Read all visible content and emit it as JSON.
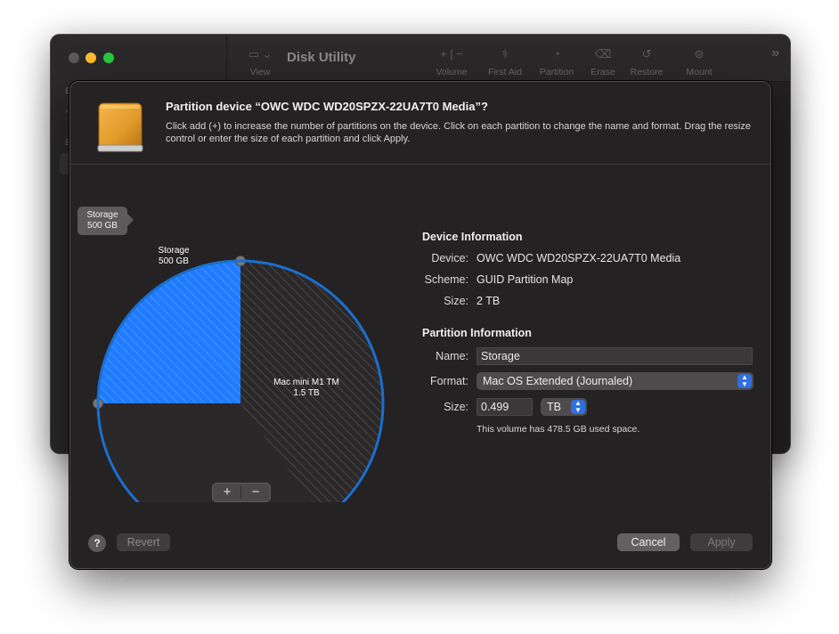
{
  "background_window": {
    "title": "Disk Utility",
    "toolbar": {
      "view_label": "View",
      "volume_label": "Volume",
      "first_aid_label": "First Aid",
      "partition_label": "Partition",
      "erase_label": "Erase",
      "restore_label": "Restore",
      "mount_label": "Mount"
    }
  },
  "sheet": {
    "title": "Partition device “OWC WDC WD20SPZX-22UA7T0 Media”?",
    "description": "Click add (+) to increase the number of partitions on the device. Click on each partition to change the name and format. Drag the resize control or enter the size of each partition and click Apply."
  },
  "chart_data": {
    "type": "pie",
    "slices": [
      {
        "name": "Storage",
        "size_label": "500 GB",
        "value": 500,
        "selected": true,
        "color": "#1f7bff"
      },
      {
        "name": "Mac mini M1 TM",
        "size_label": "1.5 TB",
        "value": 1500,
        "selected": false,
        "color": "#2a2828"
      }
    ],
    "tooltip": {
      "name": "Storage",
      "size": "500 GB"
    }
  },
  "partition_controls": {
    "add_symbol": "+",
    "remove_symbol": "−"
  },
  "device_information": {
    "heading": "Device Information",
    "device_label": "Device:",
    "device_value": "OWC WDC WD20SPZX-22UA7T0 Media",
    "scheme_label": "Scheme:",
    "scheme_value": "GUID Partition Map",
    "size_label": "Size:",
    "size_value": "2 TB"
  },
  "partition_information": {
    "heading": "Partition Information",
    "name_label": "Name:",
    "name_value": "Storage",
    "format_label": "Format:",
    "format_value": "Mac OS Extended (Journaled)",
    "size_label": "Size:",
    "size_value": "0.499",
    "unit_value": "TB",
    "usage_note": "This volume has 478.5 GB used space."
  },
  "footer": {
    "help_symbol": "?",
    "revert_label": "Revert",
    "cancel_label": "Cancel",
    "apply_label": "Apply"
  }
}
